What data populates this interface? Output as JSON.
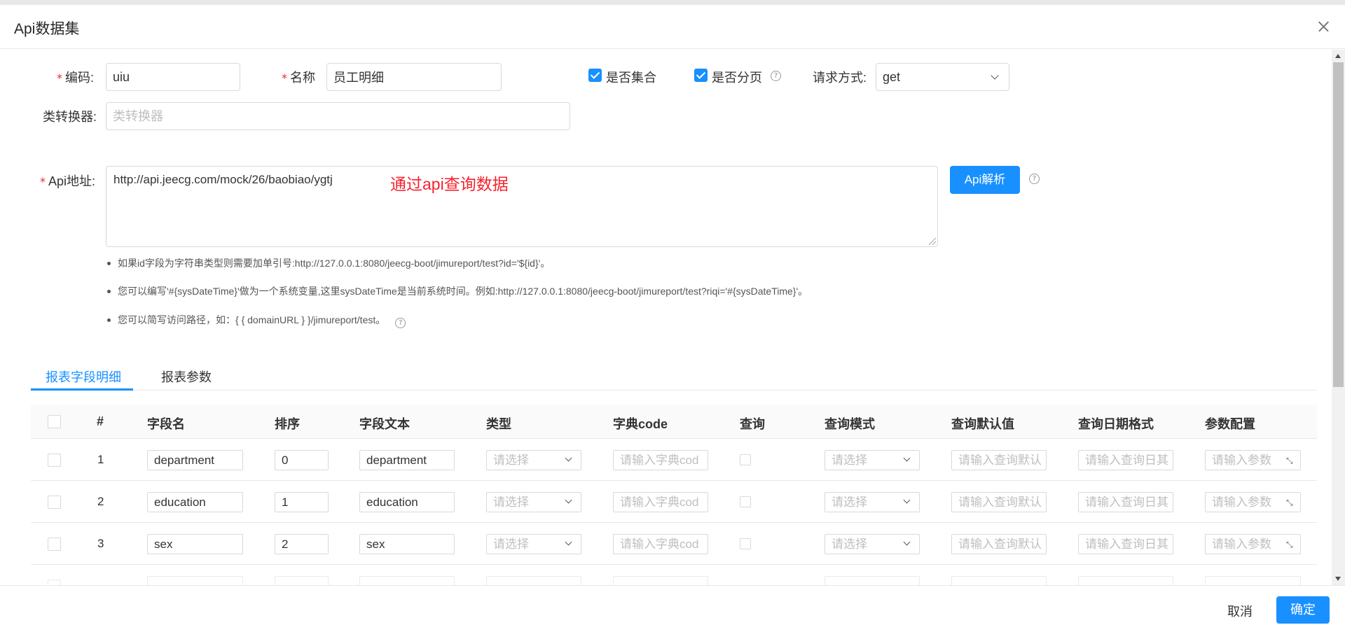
{
  "modal": {
    "title": "Api数据集"
  },
  "form": {
    "code_label": "编码:",
    "code_value": "uiu",
    "name_label": "名称",
    "name_value": "员工明细",
    "is_collection_label": "是否集合",
    "is_paged_label": "是否分页",
    "request_method_label": "请求方式:",
    "request_method_value": "get",
    "class_converter_label": "类转换器:",
    "class_converter_placeholder": "类转换器",
    "api_url_label": "Api地址:",
    "api_url_value": "http://api.jeecg.com/mock/26/baobiao/ygtj",
    "api_note": "通过api查询数据",
    "api_parse_button": "Api解析"
  },
  "hints": [
    "如果id字段为字符串类型则需要加单引号:http://127.0.0.1:8080/jeecg-boot/jimureport/test?id='${id}'。",
    "您可以编写'#{sysDateTime}'做为一个系统变量,这里sysDateTime是当前系统时间。例如:http://127.0.0.1:8080/jeecg-boot/jimureport/test?riqi='#{sysDateTime}'。",
    "您可以简写访问路径，如：{ { domainURL } }/jimureport/test。"
  ],
  "tabs": [
    "报表字段明细",
    "报表参数"
  ],
  "table": {
    "headers": [
      "#",
      "字段名",
      "排序",
      "字段文本",
      "类型",
      "字典code",
      "查询",
      "查询模式",
      "查询默认值",
      "查询日期格式",
      "参数配置"
    ],
    "placeholders": {
      "type": "请选择",
      "dict_code": "请输入字典cod",
      "query_mode": "请选择",
      "query_default": "请输入查询默认",
      "query_date_format": "请输入查询日其",
      "param_config": "请输入参数"
    },
    "rows": [
      {
        "index": "1",
        "field_name": "department",
        "order": "0",
        "field_text": "department"
      },
      {
        "index": "2",
        "field_name": "education",
        "order": "1",
        "field_text": "education"
      },
      {
        "index": "3",
        "field_name": "sex",
        "order": "2",
        "field_text": "sex"
      }
    ]
  },
  "footer": {
    "cancel_label": "取消",
    "ok_label": "确定"
  },
  "colors": {
    "primary": "#1890ff",
    "required": "#f5222d",
    "note": "#f5222d"
  }
}
